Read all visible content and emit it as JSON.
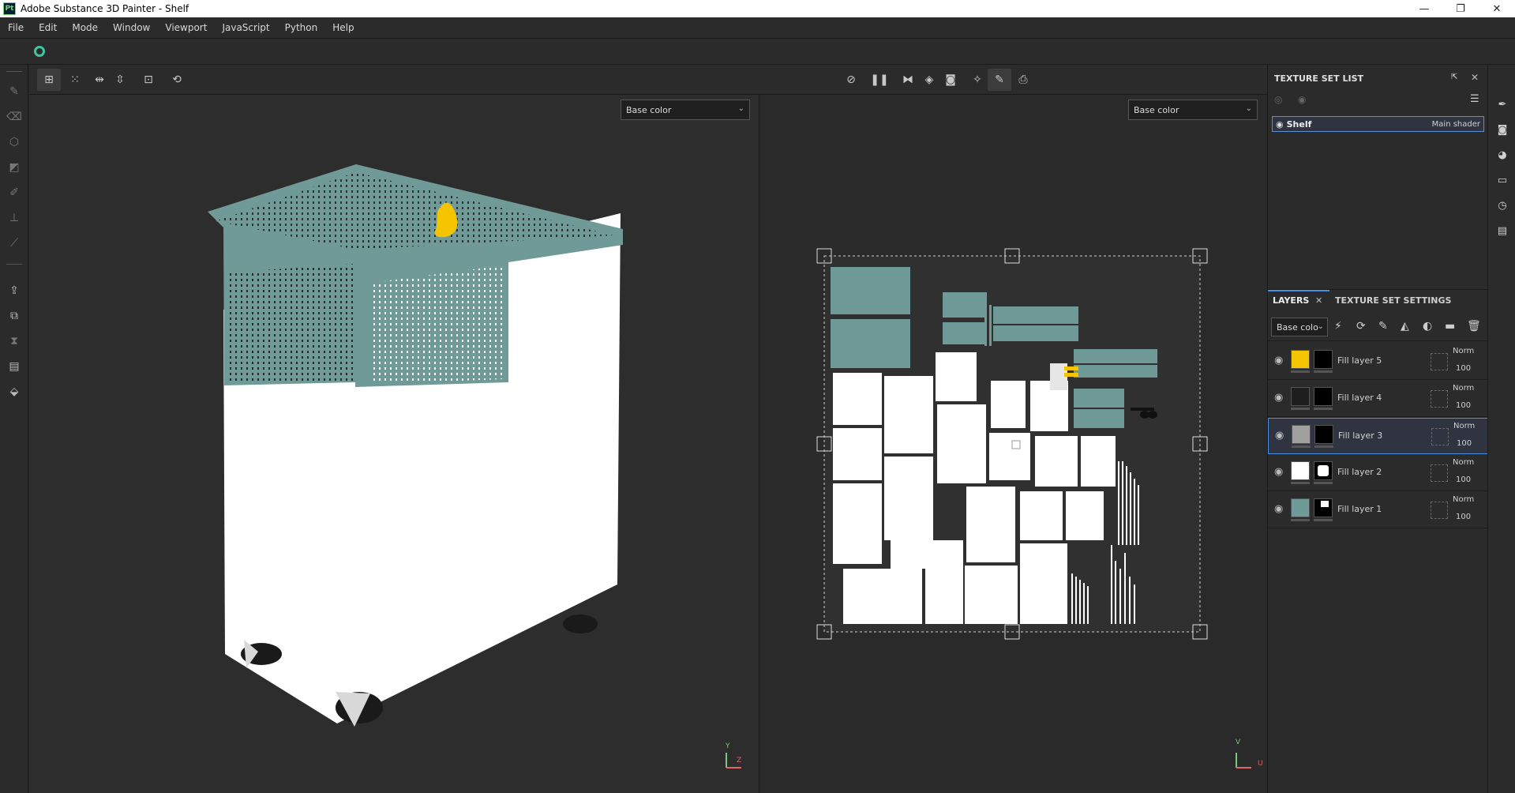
{
  "window": {
    "title": "Adobe Substance 3D Painter - Shelf",
    "app_badge": "Pt",
    "controls": [
      "—",
      "❐",
      "✕"
    ]
  },
  "menu": [
    "File",
    "Edit",
    "Mode",
    "Window",
    "Viewport",
    "JavaScript",
    "Python",
    "Help"
  ],
  "viewports": {
    "left_channel": "Base color",
    "right_channel": "Base color",
    "left_axis": {
      "y": "Y",
      "z": "Z"
    },
    "right_axis": {
      "v": "V",
      "u": "U"
    }
  },
  "texture_set_list": {
    "title": "TEXTURE SET LIST",
    "items": [
      {
        "name": "Shelf",
        "shader": "Main shader"
      }
    ]
  },
  "layers_panel": {
    "tab_layers": "LAYERS",
    "tab_close": "✕",
    "tab_settings": "TEXTURE SET SETTINGS",
    "channel": "Base colo",
    "layers": [
      {
        "name": "Fill layer 5",
        "blend": "Norm",
        "opacity": "100",
        "color": "#f5c400",
        "selected": false
      },
      {
        "name": "Fill layer 4",
        "blend": "Norm",
        "opacity": "100",
        "color": "#1e1e1e",
        "selected": false
      },
      {
        "name": "Fill layer 3",
        "blend": "Norm",
        "opacity": "100",
        "color": "#a0a0a0",
        "selected": true
      },
      {
        "name": "Fill layer 2",
        "blend": "Norm",
        "opacity": "100",
        "color": "#ffffff",
        "selected": false
      },
      {
        "name": "Fill layer 1",
        "blend": "Norm",
        "opacity": "100",
        "color": "#6f9a98",
        "selected": false
      }
    ]
  },
  "colors": {
    "teal": "#6f9a98",
    "yellow": "#f5c400",
    "accent": "#3cc6a0",
    "selection": "#4a90e2"
  }
}
